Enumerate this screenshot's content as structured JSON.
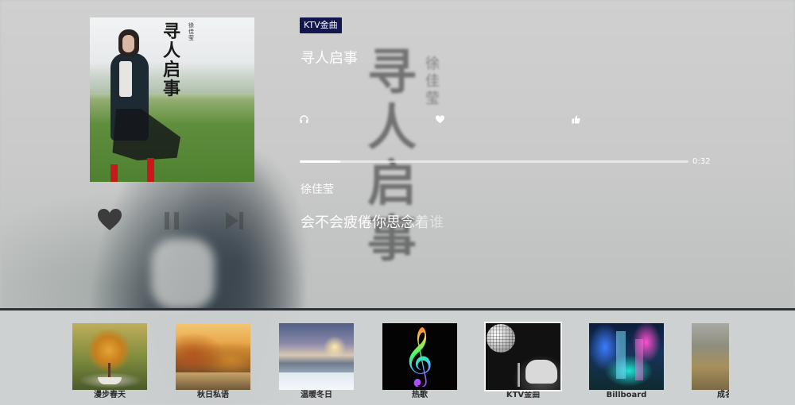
{
  "tag": "KTV金曲",
  "now_playing": {
    "title": "寻人启事",
    "artist": "徐佳莹",
    "elapsed": "0:32",
    "progress_fraction": 0.105,
    "lyric": "会不会疲倦你思念着谁"
  },
  "cover": {
    "calligraphy": "寻人启事",
    "small_text": "徐佳莹"
  },
  "controls": {
    "favorite_icon": "heart-icon",
    "pause_icon": "pause-icon",
    "next_icon": "next-icon"
  },
  "stats": {
    "listen_icon": "headphones-icon",
    "fav_icon": "heart-icon",
    "like_icon": "thumbs-up-icon"
  },
  "playlists": [
    {
      "label": "漫步春天",
      "active": false
    },
    {
      "label": "秋日私语",
      "active": false
    },
    {
      "label": "温暖冬日",
      "active": false
    },
    {
      "label": "热歌",
      "active": false
    },
    {
      "label": "KTV金曲",
      "active": true
    },
    {
      "label": "Billboard",
      "active": false
    },
    {
      "label": "成名曲",
      "active": false
    }
  ],
  "colors": {
    "tag_bg": "#14174d",
    "text": "#ffffff",
    "strip_border": "#2f3338"
  }
}
